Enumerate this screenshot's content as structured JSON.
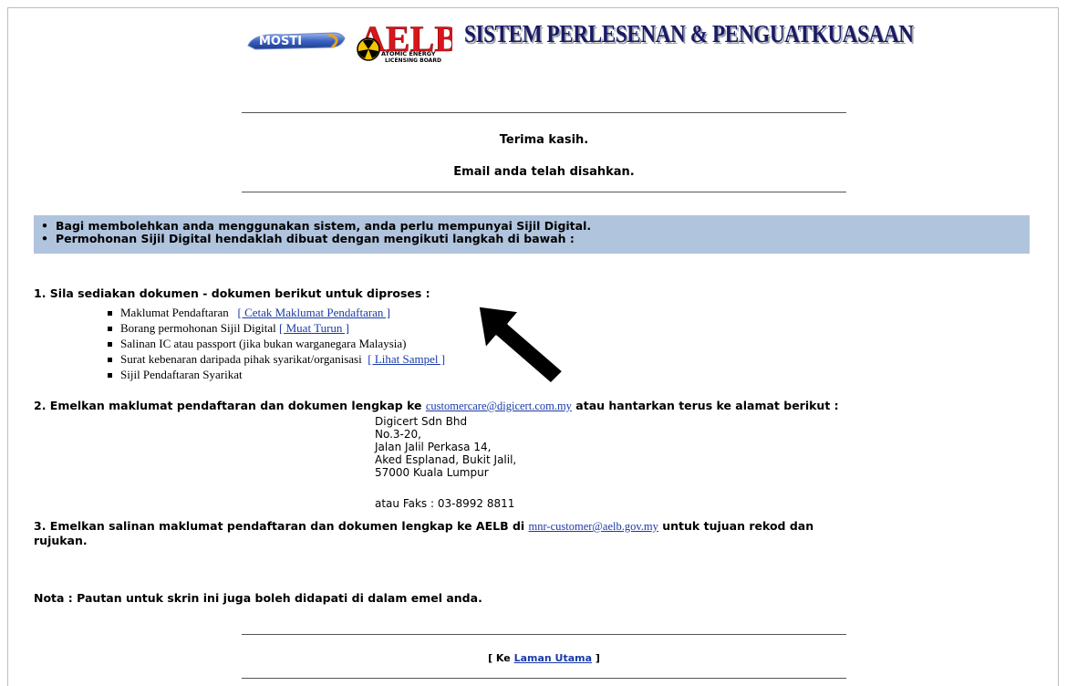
{
  "header": {
    "mosti_logo": "MOSTI",
    "aelb_logo": "AELB",
    "aelb_subtitle_1": "ATOMIC ENERGY",
    "aelb_subtitle_2": "LICENSING BOARD",
    "system_title": "SISTEM PERLESENAN & PENGUATKUASAAN"
  },
  "confirmation": {
    "thanks": "Terima kasih.",
    "message": "Email anda telah disahkan."
  },
  "notes": [
    "Bagi membolehkan anda menggunakan sistem, anda perlu mempunyai Sijil Digital.",
    "Permohonan Sijil Digital hendaklah dibuat dengan mengikuti langkah di bawah :"
  ],
  "step1": {
    "title": "1. Sila sediakan dokumen - dokumen berikut untuk diproses :",
    "items": [
      {
        "text": "Maklumat Pendaftaran",
        "link": "[ Cetak Maklumat Pendaftaran ]"
      },
      {
        "text": "Borang permohonan Sijil Digital",
        "link": "[ Muat Turun ]"
      },
      {
        "text": "Salinan IC atau passport (jika bukan warganegara Malaysia)",
        "link": ""
      },
      {
        "text": "Surat kebenaran daripada pihak syarikat/organisasi",
        "link": "[ Lihat Sampel ]"
      },
      {
        "text": "Sijil Pendaftaran Syarikat",
        "link": ""
      }
    ]
  },
  "step2": {
    "prefix": "2. Emelkan maklumat pendaftaran dan dokumen lengkap ke ",
    "email": "customercare@digicert.com.my",
    "suffix": " atau hantarkan terus ke  alamat berikut :",
    "address": [
      "Digicert Sdn Bhd",
      "No.3-20,",
      "Jalan Jalil Perkasa 14,",
      "Aked Esplanad, Bukit Jalil,",
      "57000 Kuala Lumpur"
    ],
    "fax": "atau Faks : 03-8992 8811"
  },
  "step3": {
    "prefix": "3. Emelkan salinan maklumat pendaftaran dan dokumen lengkap ke AELB di ",
    "email": "mnr-customer@aelb.gov.my",
    "suffix": "  untuk tujuan rekod dan",
    "line2": "rujukan."
  },
  "nota": "Nota : Pautan untuk skrin ini juga boleh didapati di dalam emel anda.",
  "footer": {
    "open": "[ Ke ",
    "home_link": "Laman Utama",
    "close": " ]"
  }
}
